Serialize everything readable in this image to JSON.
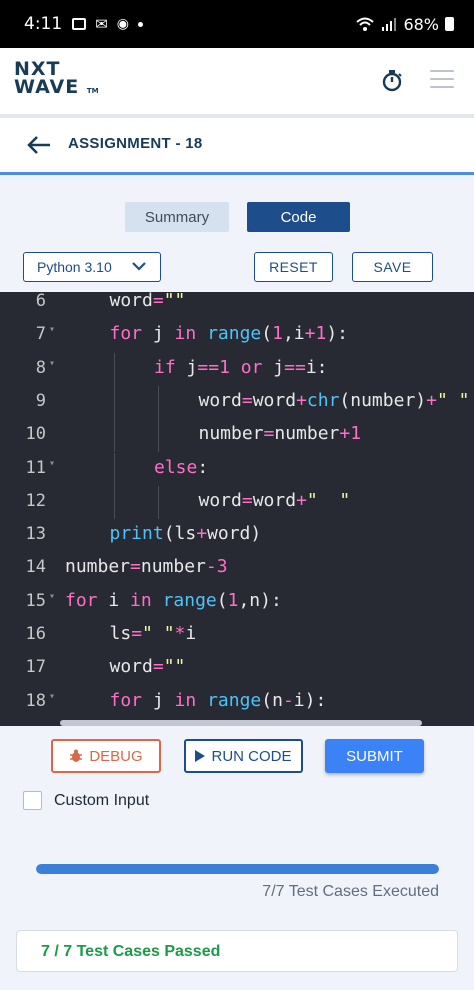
{
  "status_bar": {
    "time": "4:11",
    "battery": "68%"
  },
  "header": {
    "logo_line1": "NXT",
    "logo_line2": "WAVE",
    "logo_tm": "TM"
  },
  "assignment": {
    "title": "ASSIGNMENT - 18"
  },
  "tabs": [
    {
      "label": "Summary",
      "active": false
    },
    {
      "label": "Code",
      "active": true
    }
  ],
  "controls": {
    "language": "Python 3.10",
    "reset_label": "RESET",
    "save_label": "SAVE"
  },
  "editor": {
    "lines": [
      {
        "n": "6",
        "fold": false,
        "indent": 1,
        "code": "word=\"\""
      },
      {
        "n": "7",
        "fold": true,
        "indent": 1,
        "code": "for j in range(1,i+1):"
      },
      {
        "n": "8",
        "fold": true,
        "indent": 2,
        "code": "if j==1 or j==i:"
      },
      {
        "n": "9",
        "fold": false,
        "indent": 3,
        "code": "word=word+chr(number)+\" \""
      },
      {
        "n": "10",
        "fold": false,
        "indent": 3,
        "code": "number=number+1"
      },
      {
        "n": "11",
        "fold": true,
        "indent": 2,
        "code": "else:"
      },
      {
        "n": "12",
        "fold": false,
        "indent": 3,
        "code": "word=word+\"  \""
      },
      {
        "n": "13",
        "fold": false,
        "indent": 1,
        "code": "print(ls+word)"
      },
      {
        "n": "14",
        "fold": false,
        "indent": 0,
        "code": "number=number-3"
      },
      {
        "n": "15",
        "fold": true,
        "indent": 0,
        "code": "for i in range(1,n):"
      },
      {
        "n": "16",
        "fold": false,
        "indent": 1,
        "code": "ls=\" \"*i"
      },
      {
        "n": "17",
        "fold": false,
        "indent": 1,
        "code": "word=\"\""
      },
      {
        "n": "18",
        "fold": true,
        "indent": 1,
        "code": "for j in range(n-i):"
      }
    ]
  },
  "actions": {
    "debug_label": "DEBUG",
    "run_label": "RUN CODE",
    "submit_label": "SUBMIT"
  },
  "custom_input": {
    "label": "Custom Input",
    "checked": false
  },
  "results": {
    "progress_fraction": 1.0,
    "executed_text": "7/7 Test Cases Executed",
    "passed_text": "7 / 7 Test Cases Passed"
  },
  "colors": {
    "brand_dark": "#183b56",
    "primary": "#1e4d8c",
    "accent": "#3b82f6",
    "success": "#1c9a4a",
    "debug": "#d9694a",
    "editor_bg": "#272a33"
  }
}
